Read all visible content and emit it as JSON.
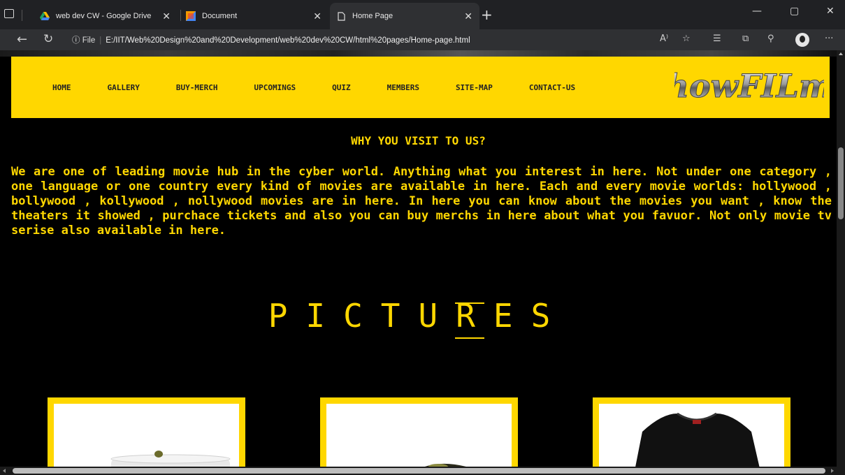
{
  "browser": {
    "tabs": [
      {
        "title": "web dev CW - Google Drive",
        "icon": "google-drive-icon"
      },
      {
        "title": "Document",
        "icon": "document-icon"
      },
      {
        "title": "Home Page",
        "icon": "page-icon",
        "active": true
      }
    ],
    "new_tab": "+",
    "minimize": "—",
    "restore": "▢",
    "close": "✕",
    "url_label": "File",
    "url": "E:/IIT/Web%20Design%20and%20Development/web%20dev%20CW/html%20pages/Home-page.html",
    "read_aloud": "A⁾",
    "more": "···"
  },
  "site": {
    "nav": [
      "HOME",
      "GALLERY",
      "BUY-MERCH",
      "UPCOMINGS",
      "QUIZ",
      "MEMBERS",
      "SITE-MAP",
      "CONTACT-US"
    ],
    "logo_text": "howFILm",
    "section_title": "WHY YOU VISIT TO US?",
    "about": "We are one of leading movie hub in the cyber world. Anything what you interest in here. Not under one category , one language or one country every kind of movies are available in here. Each and every movie worlds: hollywood , bollywood , kollywood , nollywood movies are in here. In here you can know about the movies you want , know the theaters it showed , purchace tickets and also you can buy merchs in here about what you favuor. Not only movie tv serise also available in here.",
    "pictures_heading": "PICTURES",
    "cards": [
      {
        "item": "mug-image"
      },
      {
        "item": "cap-image"
      },
      {
        "item": "tshirt-image"
      }
    ],
    "accent_color": "#ffd700"
  }
}
